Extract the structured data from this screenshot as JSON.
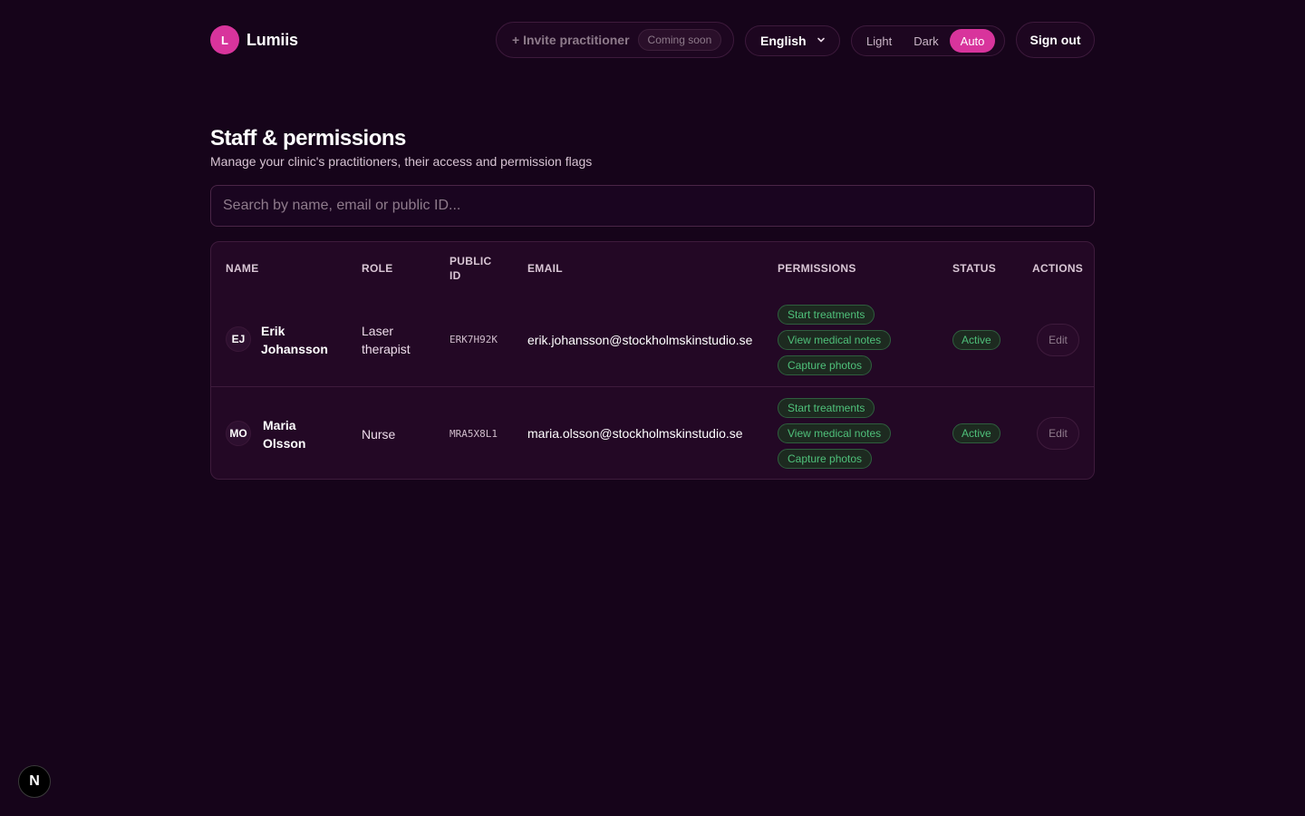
{
  "brand": {
    "initial": "L",
    "name": "Lumiis"
  },
  "header": {
    "invite_label": "+ Invite practitioner",
    "invite_badge": "Coming soon",
    "language": "English",
    "theme_options": [
      "Light",
      "Dark",
      "Auto"
    ],
    "theme_selected": "Auto",
    "sign_out": "Sign out"
  },
  "page": {
    "title": "Staff & permissions",
    "subtitle": "Manage your clinic's practitioners, their access and permission flags",
    "search_placeholder": "Search by name, email or public ID..."
  },
  "table": {
    "columns": {
      "name": "NAME",
      "role": "ROLE",
      "public_id": "PUBLIC\nID",
      "email": "EMAIL",
      "permissions": "PERMISSIONS",
      "status": "STATUS",
      "actions": "ACTIONS"
    },
    "rows": [
      {
        "initials": "EJ",
        "first_name": "Erik",
        "last_name": "Johansson",
        "role_line1": "Laser",
        "role_line2": "therapist",
        "public_id": "ERK7H92K",
        "email": "erik.johansson@stockholmskinstudio.se",
        "permissions": [
          "Start treatments",
          "View medical notes",
          "Capture photos"
        ],
        "status": "Active",
        "action": "Edit"
      },
      {
        "initials": "MO",
        "first_name": "Maria",
        "last_name": "Olsson",
        "role_line1": "Nurse",
        "role_line2": "",
        "public_id": "MRA5X8L1",
        "email": "maria.olsson@stockholmskinstudio.se",
        "permissions": [
          "Start treatments",
          "View medical notes",
          "Capture photos"
        ],
        "status": "Active",
        "action": "Edit"
      }
    ]
  },
  "dev_badge": "N",
  "colors": {
    "background": "#16041a",
    "accent": "#d8349c",
    "status_green": "#4fc07a",
    "card": "#230825"
  }
}
